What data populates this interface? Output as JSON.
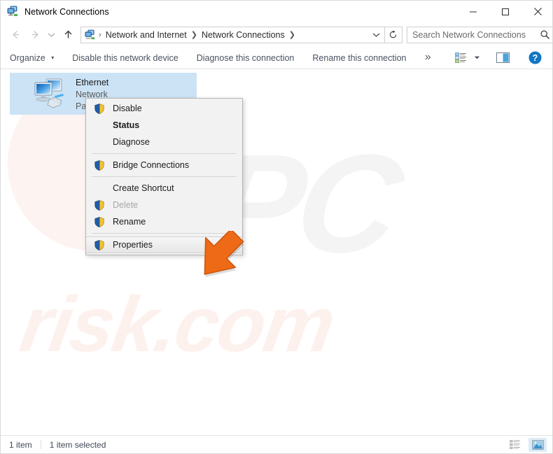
{
  "window": {
    "title": "Network Connections",
    "icon": "network-connections-icon",
    "controls": {
      "minimize": "–",
      "maximize": "☐",
      "close": "✕"
    }
  },
  "nav": {
    "back": "←",
    "forward": "→",
    "recent": "⌄",
    "up": "↑",
    "breadcrumb": {
      "icon": "network-folder-icon",
      "lead_sep": "›",
      "items": [
        "Network and Internet",
        "Network Connections"
      ],
      "separator": "❯",
      "trailing_separator": "❯",
      "dropdown": "⌄"
    },
    "refresh": "↻",
    "search": {
      "placeholder": "Search Network Connections",
      "value": "",
      "icon": "search-icon"
    }
  },
  "commandbar": {
    "items": [
      {
        "label": "Organize",
        "has_caret": true
      },
      {
        "label": "Disable this network device",
        "has_caret": false
      },
      {
        "label": "Diagnose this connection",
        "has_caret": false
      },
      {
        "label": "Rename this connection",
        "has_caret": false
      }
    ],
    "overflow": "»",
    "view_options_icon": "view-options-icon",
    "view_options_caret": "▾",
    "preview_pane_icon": "preview-pane-icon",
    "help_icon": "help-icon",
    "help_glyph": "?"
  },
  "content": {
    "watermark_pc": "PC",
    "watermark_site": "risk.com",
    "item": {
      "icon": "ethernet-adapter-icon",
      "name": "Ethernet",
      "line2": "Network",
      "line3": "Pa"
    }
  },
  "context_menu": {
    "items": [
      {
        "label": "Disable",
        "shield": true,
        "bold": false,
        "disabled": false,
        "highlighted": false,
        "separator_after": false
      },
      {
        "label": "Status",
        "shield": false,
        "bold": true,
        "disabled": false,
        "highlighted": false,
        "separator_after": false
      },
      {
        "label": "Diagnose",
        "shield": false,
        "bold": false,
        "disabled": false,
        "highlighted": false,
        "separator_after": true
      },
      {
        "label": "Bridge Connections",
        "shield": true,
        "bold": false,
        "disabled": false,
        "highlighted": false,
        "separator_after": true
      },
      {
        "label": "Create Shortcut",
        "shield": false,
        "bold": false,
        "disabled": false,
        "highlighted": false,
        "separator_after": false
      },
      {
        "label": "Delete",
        "shield": true,
        "bold": false,
        "disabled": true,
        "highlighted": false,
        "separator_after": false
      },
      {
        "label": "Rename",
        "shield": true,
        "bold": false,
        "disabled": false,
        "highlighted": false,
        "separator_after": true
      },
      {
        "label": "Properties",
        "shield": true,
        "bold": false,
        "disabled": false,
        "highlighted": true,
        "separator_after": false
      }
    ]
  },
  "cursor": {
    "name": "pointer-arrow",
    "color": "#ef6a16"
  },
  "statusbar": {
    "item_count": "1 item",
    "selection": "1 item selected",
    "details_view_icon": "details-view-icon",
    "large_icons_view_icon": "large-icons-view-icon"
  },
  "colors": {
    "selection_blue": "#cce3f5",
    "accent_blue": "#0078d7",
    "shield_blue": "#1f5fa9",
    "shield_gold": "#f2c230",
    "cursor_orange": "#ef6a16"
  }
}
